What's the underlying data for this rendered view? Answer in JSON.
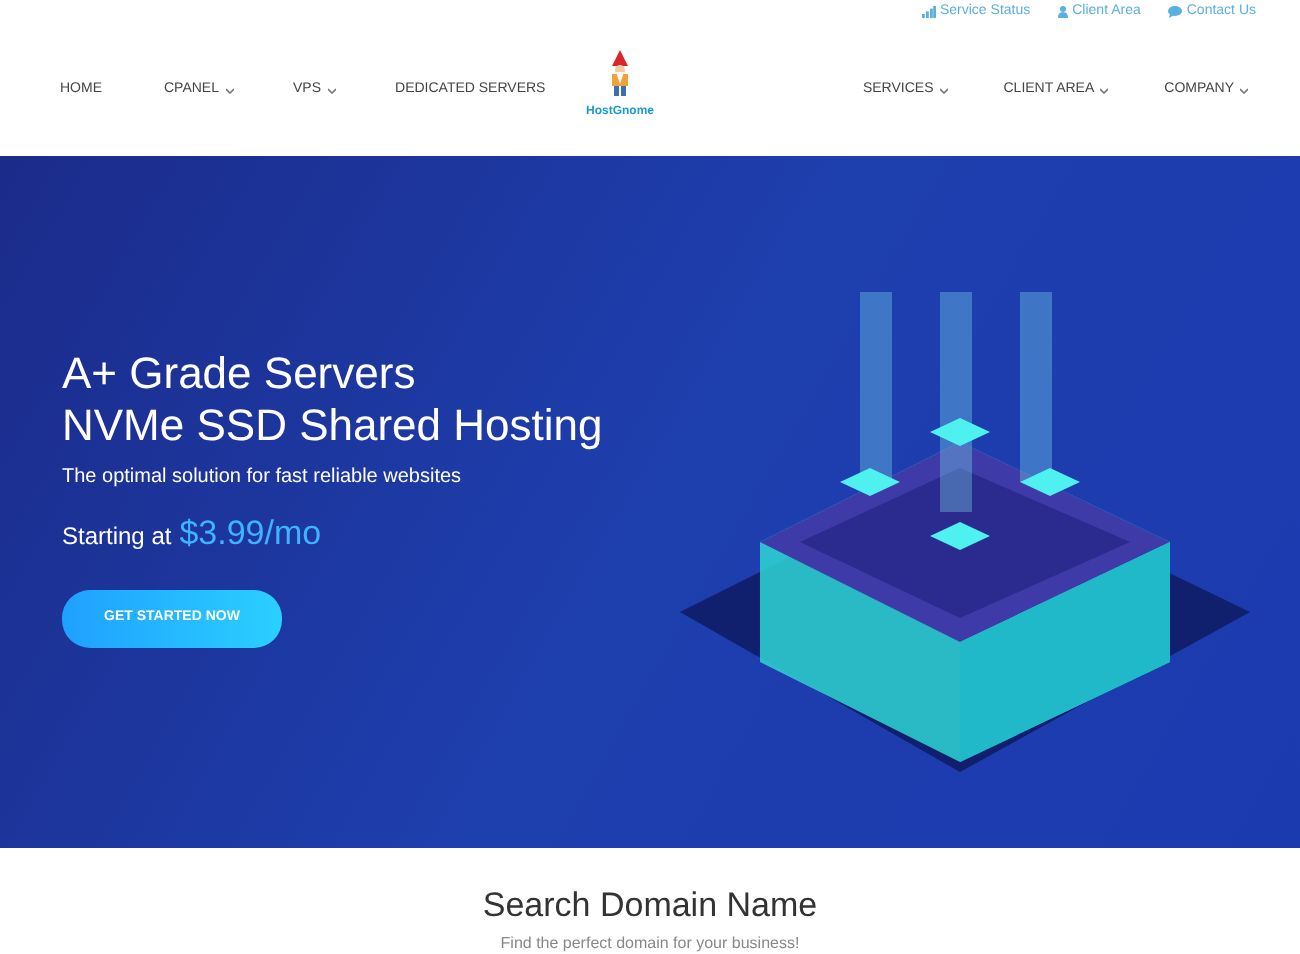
{
  "top_links": [
    {
      "kind": "signal",
      "label": "Service Status"
    },
    {
      "kind": "user",
      "label": "Client Area"
    },
    {
      "kind": "chat",
      "label": "Contact Us"
    }
  ],
  "nav_left": [
    {
      "label": "HOME",
      "dropdown": false
    },
    {
      "label": "CPANEL",
      "dropdown": true
    },
    {
      "label": "VPS",
      "dropdown": true
    },
    {
      "label": "DEDICATED SERVERS",
      "dropdown": false
    }
  ],
  "logo": {
    "text": "HostGnome"
  },
  "nav_right": [
    {
      "label": "SERVICES",
      "dropdown": true
    },
    {
      "label": "CLIENT AREA",
      "dropdown": true
    },
    {
      "label": "COMPANY",
      "dropdown": true
    }
  ],
  "hero": {
    "title_lines": [
      "A+ Grade Servers",
      "NVMe SSD Shared Hosting"
    ],
    "subtitle": "The optimal solution for fast reliable websites",
    "price_prefix": "Starting at",
    "price": "$3.99/mo",
    "button": "GET STARTED NOW"
  },
  "domain_section": {
    "title": "Search Domain Name",
    "subtitle": "Find the perfect domain for your business!"
  }
}
